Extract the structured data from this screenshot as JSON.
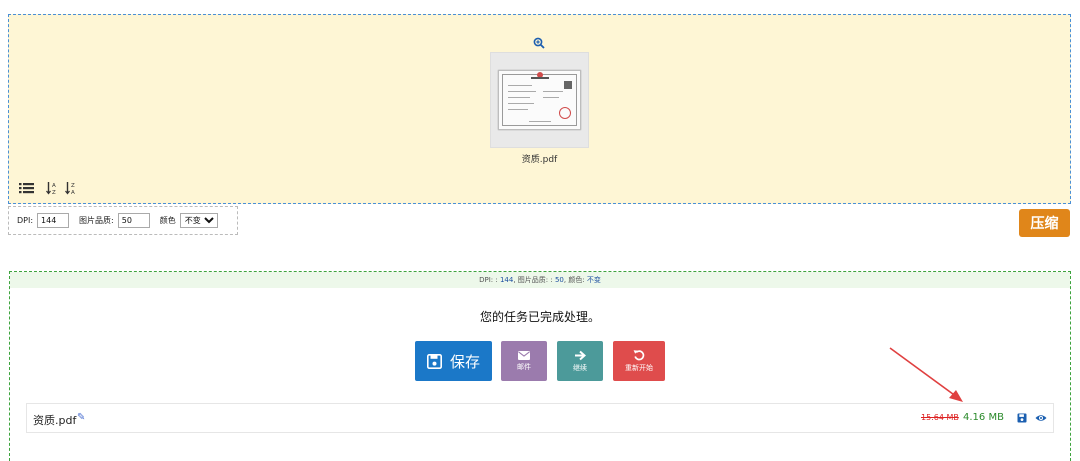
{
  "dropzone": {
    "file": {
      "name": "资质.pdf"
    },
    "icons": [
      "zoom-in-icon",
      "list-icon",
      "sort-az-icon",
      "sort-za-icon"
    ]
  },
  "options": {
    "dpi_label": "DPI:",
    "dpi_value": "144",
    "quality_label": "图片品质:",
    "quality_value": "50",
    "color_label": "颜色",
    "color_selected": "不变",
    "compress_label": "压缩",
    "compress_color": "#e0861a"
  },
  "result": {
    "settings_prefix_dpi": "DPI: :",
    "dpi": "144",
    "settings_quality": ", 图片品质: :",
    "quality": "50",
    "settings_color": ", 颜色:",
    "color": "不变",
    "message": "您的任务已完成处理。",
    "buttons": {
      "save": "保存",
      "mail": "邮件",
      "continue": "继续",
      "restart": "重新开始"
    },
    "file": {
      "name": "资质.pdf",
      "original_size": "15.64 MB",
      "new_size": "4.16 MB"
    }
  }
}
